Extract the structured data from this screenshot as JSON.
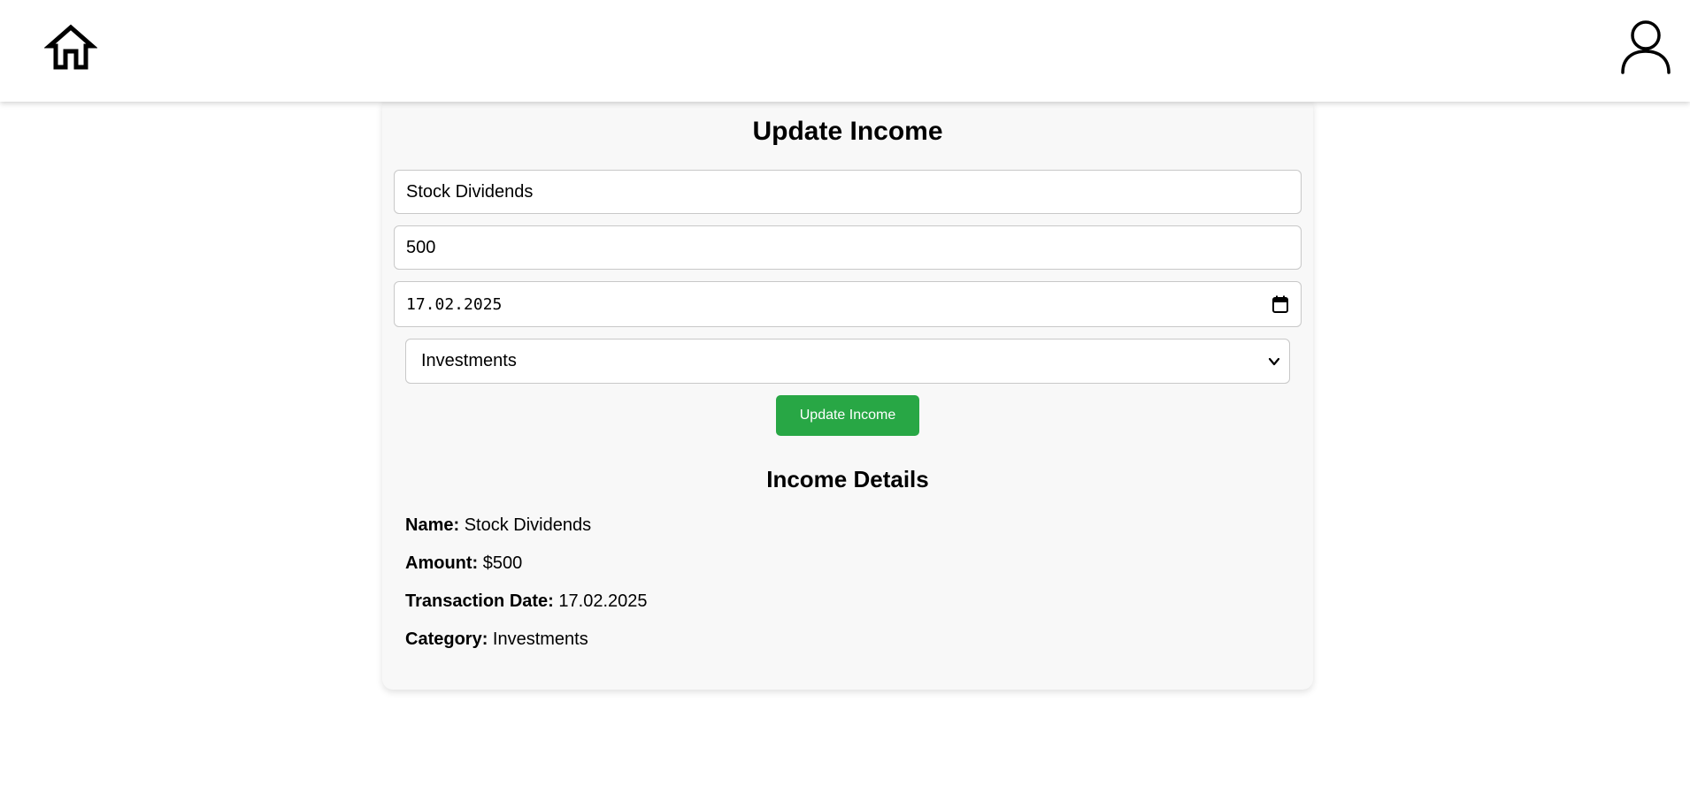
{
  "header": {
    "home_icon": "home-icon",
    "profile_icon": "user-icon"
  },
  "form": {
    "title": "Update Income",
    "name_value": "Stock Dividends",
    "amount_value": "500",
    "date_value": "17.02.2025",
    "category_value": "Investments",
    "submit_label": "Update Income",
    "accent_color": "#28a745"
  },
  "details": {
    "title": "Income Details",
    "name_label": "Name:",
    "name_value": "Stock Dividends",
    "amount_label": "Amount:",
    "amount_value": "$500",
    "date_label": "Transaction Date:",
    "date_value": "17.02.2025",
    "category_label": "Category:",
    "category_value": "Investments"
  }
}
